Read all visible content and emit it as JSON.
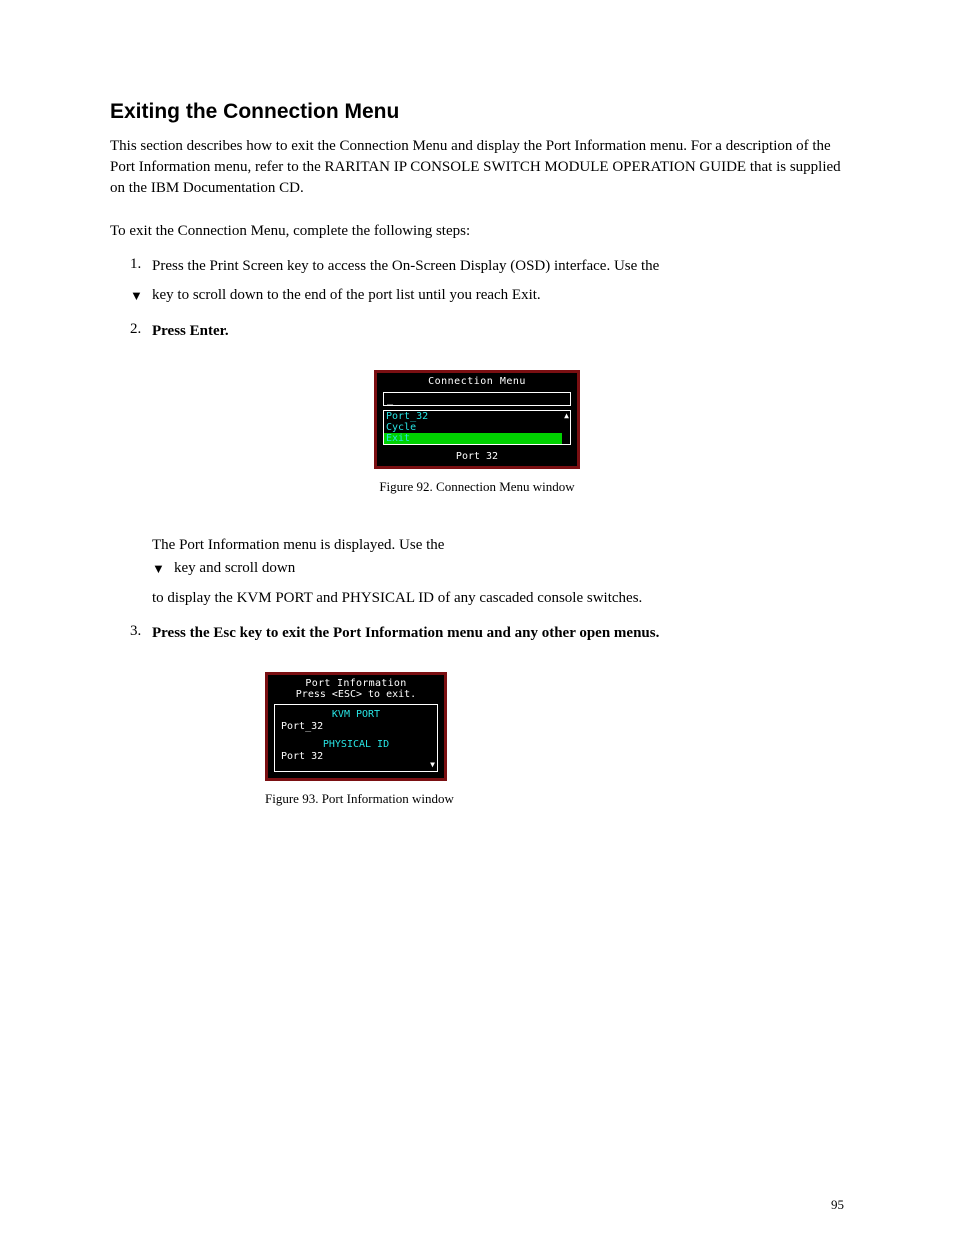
{
  "section_title": "Exiting the Connection Menu",
  "intro_text": "This section describes how to exit the Connection Menu and display the Port Information menu. For a description of the Port Information menu, refer to the RARITAN IP CONSOLE SWITCH MODULE OPERATION GUIDE that is supplied on the IBM Documentation CD.",
  "pre_steps": "To exit the Connection Menu, complete the following steps:",
  "step1_num": "1.",
  "step1_text": "Press the Print Screen key to access the On-Screen Display (OSD) interface. Use the",
  "step1_arrow_tail": "key to scroll down to the end of the port list until you reach Exit.",
  "step2_num": "2.",
  "step2_text": "Press Enter.",
  "fig92_caption": "Figure 92. Connection Menu window",
  "step3_text": "The Port Information menu is displayed. Use the",
  "step3_arrow_tail": " key and scroll down",
  "step3_text2": "to display the KVM PORT and PHYSICAL ID of any cascaded console switches.",
  "step4_num": "3.",
  "step4_text": "Press the Esc key to exit the Port Information menu and any other open menus.",
  "fig93_caption": "Figure 93. Port Information window",
  "conn_menu": {
    "title": "Connection Menu",
    "field_text": "_",
    "items": [
      "Port_32",
      "Cycle",
      "Exit"
    ],
    "footer": "Port 32"
  },
  "port_info": {
    "title": "Port Information",
    "subtitle": "Press <ESC> to exit.",
    "kvm_label": "KVM PORT",
    "kvm_value": "Port_32",
    "phys_label": "PHYSICAL ID",
    "phys_value": "Port 32"
  },
  "page_num": "95"
}
